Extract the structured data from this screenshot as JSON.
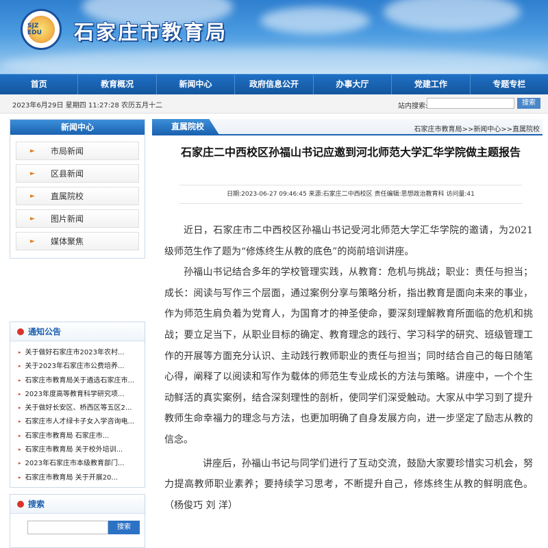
{
  "header": {
    "site_title": "石家庄市教育局",
    "logo_text": "SJZ EDU"
  },
  "nav": [
    "首页",
    "教育概况",
    "新闻中心",
    "政府信息公开",
    "办事大厅",
    "党建工作",
    "专题专栏"
  ],
  "infobar": {
    "date": "2023年6月29日 星期四 11:27:28 农历五月十二",
    "search_label": "站内搜索:",
    "search_button": "搜索"
  },
  "sidebar": {
    "title": "新闻中心",
    "items": [
      "市局新闻",
      "区县新闻",
      "直属院校",
      "图片新闻",
      "媒体聚焦"
    ]
  },
  "notices": {
    "title": "通知公告",
    "items": [
      "关于做好石家庄市2023年农村...",
      "关于2023年石家庄市公费培养...",
      "石家庄市教育局关于遴选石家庄市...",
      "2023年度高等教育科学研究项...",
      "关于做好长安区、桥西区等五区2...",
      "石家庄市人才绿卡子女入学咨询电...",
      "石家庄市教育局 石家庄市...",
      "石家庄市教育局 关于校外培训...",
      "2023年石家庄市本级教育部门...",
      "石家庄市教育局 关于开展20..."
    ]
  },
  "search_box": {
    "title": "搜索",
    "button": "搜索"
  },
  "main": {
    "tab": "直属院校",
    "breadcrumb": "石家庄市教育局>>新闻中心>>直属院校",
    "title": "石家庄二中西校区孙福山书记应邀到河北师范大学汇华学院做主题报告",
    "meta": "日期:2023-06-27 09:46:45    来源:石家庄二中西校区    责任编辑:思想政治教育科    访问量:41",
    "paragraphs": [
      "近日，石家庄市二中西校区孙福山书记受河北师范大学汇华学院的邀请，为2021级师范生作了题为“修炼终生从教的底色”的岗前培训讲座。",
      "孙福山书记结合多年的学校管理实践，从教育：危机与挑战；职业：责任与担当；成长：阅读与写作三个层面，通过案例分享与策略分析，指出教育是面向未来的事业，作为师范生肩负着为党育人，为国育才的神圣使命，要深刻理解教育所面临的危机和挑战；要立足当下，从职业目标的确定、教育理念的践行、学习科学的研究、班级管理工作的开展等方面充分认识、主动践行教师职业的责任与担当；同时结合自己的每日随笔心得，阐释了以阅读和写作为载体的师范生专业成长的方法与策略。讲座中，一个个生动鲜活的真实案例，结合深刻理性的剖析，使同学们深受触动。大家从中学习到了提升教师生命幸福力的理念与方法，也更加明确了自身发展方向，进一步坚定了励志从教的信念。",
      "讲座后，孙福山书记与同学们进行了互动交流，鼓励大家要珍惜实习机会，努力提高教师职业素养；要持续学习思考，不断提升自己，修炼终生从教的鲜明底色。（杨俊巧 刘 洋）"
    ]
  }
}
